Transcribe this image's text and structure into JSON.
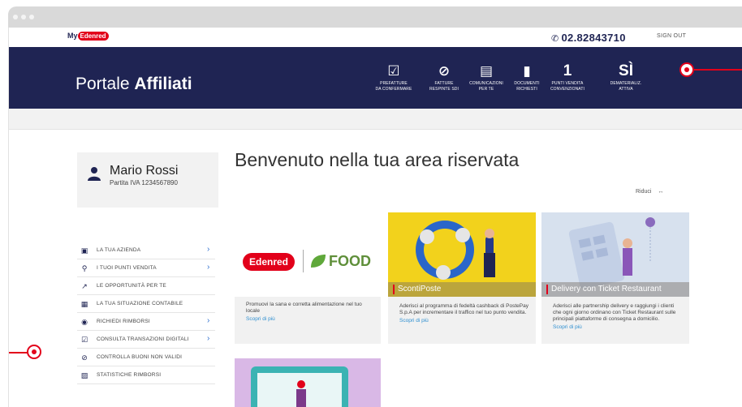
{
  "header": {
    "logo_my": "My",
    "logo_brand": "Edenred",
    "phone": "02.82843710",
    "signout": "SIGN OUT"
  },
  "nav": {
    "title_light": "Portale ",
    "title_bold": "Affiliati",
    "stats": [
      {
        "icon": "check-box-icon",
        "glyph": "☑",
        "label_line1": "PREFATTURE",
        "label_line2": "DA CONFERMARE"
      },
      {
        "icon": "blocked-icon",
        "glyph": "⊘",
        "label_line1": "FATTURE",
        "label_line2": "RESPINTE SDI"
      },
      {
        "icon": "message-icon",
        "glyph": "▤",
        "label_line1": "COMUNICAZIONI",
        "label_line2": "PER TE"
      },
      {
        "icon": "document-icon",
        "glyph": "▮",
        "label_line1": "DOCUMENTI",
        "label_line2": "RICHIESTI"
      },
      {
        "value": "1",
        "label_line1": "PUNTI VENDITA",
        "label_line2": "CONVENZIONATI"
      },
      {
        "value": "SÌ",
        "label_line1": "DEMATERIALIZ.",
        "label_line2": "ATTIVA"
      }
    ]
  },
  "user": {
    "name": "Mario Rossi",
    "vat": "Partita IVA 1234567890"
  },
  "menu": [
    {
      "icon": "building-icon",
      "glyph": "▣",
      "label": "LA TUA AZIENDA",
      "arrow": true
    },
    {
      "icon": "location-pin-icon",
      "glyph": "⚲",
      "label": "I TUOI PUNTI VENDITA",
      "arrow": true
    },
    {
      "icon": "trend-icon",
      "glyph": "↗",
      "label": "LE OPPORTUNITÀ PER TE",
      "arrow": false
    },
    {
      "icon": "calculator-icon",
      "glyph": "▦",
      "label": "LA TUA SITUAZIONE CONTABILE",
      "arrow": false
    },
    {
      "icon": "coins-icon",
      "glyph": "◉",
      "label": "RICHIEDI RIMBORSI",
      "arrow": true
    },
    {
      "icon": "check-box-icon",
      "glyph": "☑",
      "label": "CONSULTA TRANSAZIONI DIGITALI",
      "arrow": true
    },
    {
      "icon": "blocked-icon",
      "glyph": "⊘",
      "label": "CONTROLLA BUONI NON VALIDI",
      "arrow": false
    },
    {
      "icon": "chart-icon",
      "glyph": "▨",
      "label": "STATISTICHE RIMBORSI",
      "arrow": false
    }
  ],
  "main": {
    "welcome": "Benvenuto nella tua area riservata",
    "riduci": "Riduci",
    "riduci_icon": "↔",
    "cards": [
      {
        "brand_left": "Edenred",
        "brand_right": "FOOD",
        "desc": "Promuovi la sana e corretta alimentazione nel tuo locale",
        "more": "Scopri di più"
      },
      {
        "caption": "ScontiPoste",
        "desc": "Aderisci al programma di fedeltà cashback di PostePay S.p.A per incrementare il traffico nel tuo punto vendita.",
        "more": "Scopri di più"
      },
      {
        "caption": "Delivery con Ticket Restaurant",
        "desc": "Aderisci alle partnership delivery e raggiungi i clienti che ogni giorno ordinano con Ticket Restaurant sulle principali piattaforme di consegna a domicilio.",
        "more": "Scopri di più"
      }
    ]
  },
  "colors": {
    "navy": "#1f2453",
    "edenred_red": "#e2001a",
    "link_blue": "#2f8fd0",
    "panel_gray": "#f2f2f2"
  }
}
